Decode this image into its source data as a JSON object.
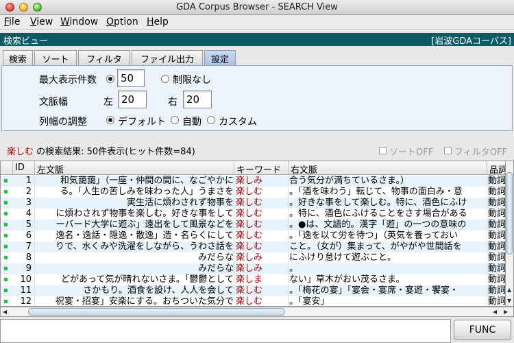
{
  "window": {
    "title": "GDA Corpus Browser - SEARCH View"
  },
  "menu": [
    {
      "u": "F",
      "rest": "ile"
    },
    {
      "u": "V",
      "rest": "iew"
    },
    {
      "u": "W",
      "rest": "indow"
    },
    {
      "u": "O",
      "rest": "ption"
    },
    {
      "u": "H",
      "rest": "elp"
    }
  ],
  "panel": {
    "title": "検索ビュー",
    "corpus": "[岩波GDAコーパス]"
  },
  "tabs": [
    "検索",
    "ソート",
    "フィルタ",
    "ファイル出力",
    "設定"
  ],
  "active_tab": "設定",
  "settings": {
    "max_display_label": "最大表示件数",
    "max_display_value": "50",
    "unlimited_label": "制限なし",
    "context_width_label": "文脈幅",
    "left_label": "左",
    "left_value": "20",
    "right_label": "右",
    "right_value": "20",
    "column_adjust_label": "列幅の調整",
    "default_label": "デフォルト",
    "auto_label": "自動",
    "custom_label": "カスタム"
  },
  "status": {
    "keyword": "楽しむ",
    "text": " の検索結果: 50件表示(ヒット件数=84)"
  },
  "options": {
    "sort_off": "ソートOFF",
    "filter_off": "フィルタOFF"
  },
  "table": {
    "headers": [
      "ID",
      "左文脈",
      "キーワード",
      "右文脈",
      "品詞"
    ],
    "rows": [
      {
        "id": "1",
        "left": "和気藹藹」（一座・仲間の間に、なごやかに",
        "kw": "楽しみ",
        "right": "合う気分が満ちているさま。）",
        "pos": "動詞"
      },
      {
        "id": "2",
        "left": "る。「人生の苦しみを味わった人」うまさを",
        "kw": "楽しむ",
        "right": "。「酒を味わう」転じて、物事の面白み・意",
        "pos": "動詞"
      },
      {
        "id": "3",
        "left": "実生活に煩わされず物事を",
        "kw": "楽しむ",
        "right": "。好きな事をして楽しむ。特に、酒色にふけ",
        "pos": "動詞"
      },
      {
        "id": "4",
        "left": "に煩わされず物事を楽しむ。好きな事をして",
        "kw": "楽しむ",
        "right": "。特に、酒色にふけることをさす場合がある",
        "pos": "動詞"
      },
      {
        "id": "5",
        "left": "ーバード大学に遊ぶ」遠出をして風景などを",
        "kw": "楽しむ",
        "right": "。●は、文語的。漢字「遊」の一つの意味の",
        "pos": "動詞"
      },
      {
        "id": "6",
        "left": "逸名・逸話・隠逸・散逸」造・名らくにして",
        "kw": "楽しむ",
        "right": "。「逸を以て労を待つ」（英気を養っておい",
        "pos": "動詞"
      },
      {
        "id": "7",
        "left": "りで、水くみや洗濯をしながら、うわさ話を",
        "kw": "楽しむ",
        "right": "こと。（女が）集まって、がやがや世間話を",
        "pos": "動詞"
      },
      {
        "id": "8",
        "left": "みだらな",
        "kw": "楽しみ",
        "right": "にふけり怠けて遊ぶこと。",
        "pos": "動詞"
      },
      {
        "id": "9",
        "left": "みだらな",
        "kw": "楽しみ",
        "right": "。",
        "pos": "動詞"
      },
      {
        "id": "10",
        "left": "どがあって気が晴れないさま。「鬱鬱として",
        "kw": "楽しま",
        "right": "ない」草木がおい茂るさま。",
        "pos": "動詞"
      },
      {
        "id": "11",
        "left": "さかもり。酒食を設け、人人を会して",
        "kw": "楽しむ",
        "right": "。「梅花の宴」「宴会・宴席・宴遊・饗宴・",
        "pos": "動詞"
      },
      {
        "id": "12",
        "left": "祝宴・招宴」安楽にする。おちついた気分で",
        "kw": "楽しむ",
        "right": "。「宴安」",
        "pos": "動詞"
      }
    ]
  },
  "func_button": "FUNC"
}
